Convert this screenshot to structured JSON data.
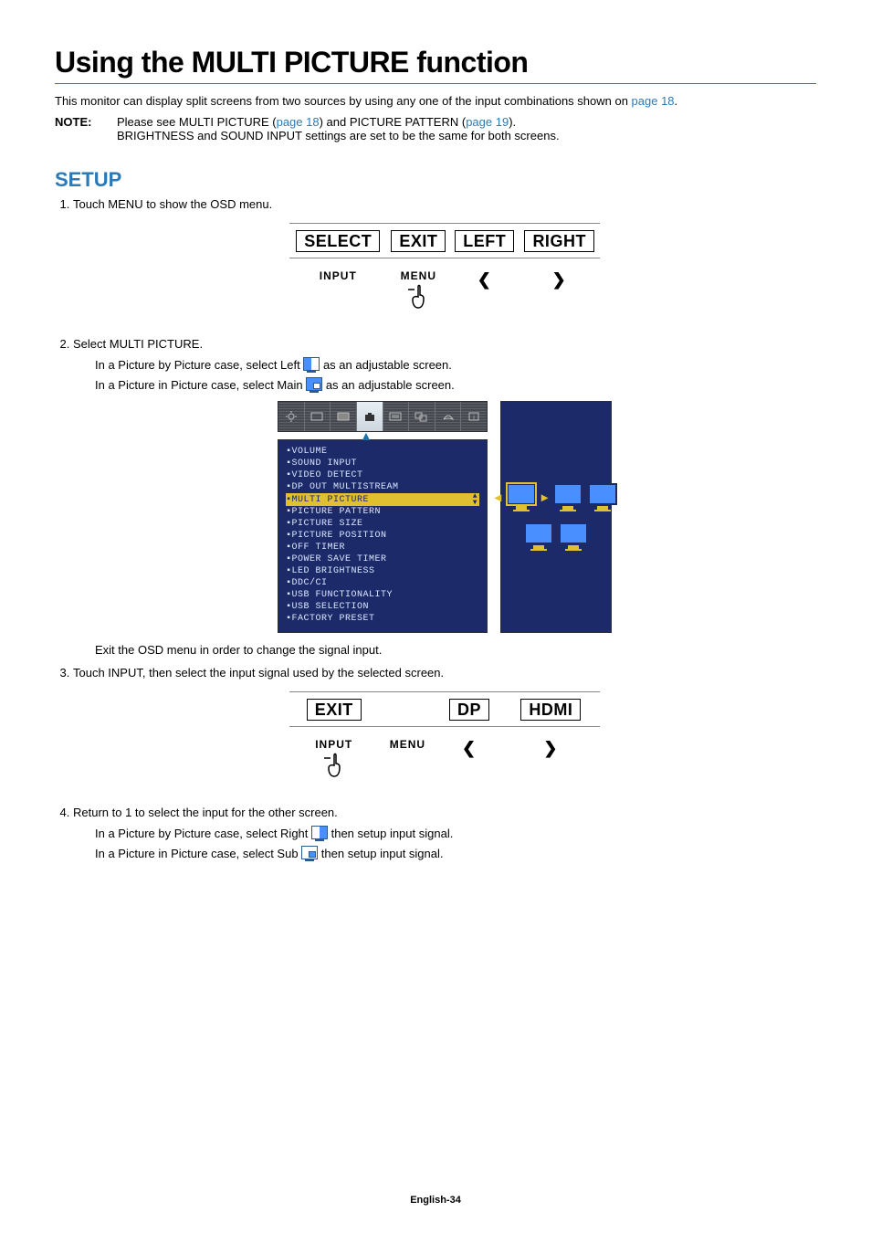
{
  "title": "Using the MULTI PICTURE function",
  "intro": "This monitor can display split screens from two sources by using any one of the input combinations shown on ",
  "intro_link": "page 18",
  "intro_after": ".",
  "note_label": "NOTE:",
  "note1_a": "Please see MULTI PICTURE (",
  "note1_link1": "page 18",
  "note1_b": ") and PICTURE PATTERN (",
  "note1_link2": "page 19",
  "note1_c": ").",
  "note2": "BRIGHTNESS and SOUND INPUT settings are set to be the same for both screens.",
  "setup_heading": "SETUP",
  "step1": "Touch MENU to show the OSD menu.",
  "step2_head": "Select MULTI PICTURE.",
  "step2_a1": "In a Picture by Picture case, select Left ",
  "step2_a2": " as an adjustable screen.",
  "step2_b1": "In a Picture in Picture case, select Main ",
  "step2_b2": " as an adjustable screen.",
  "step2_exit": "Exit the OSD menu in order to change the signal input.",
  "step3": "Touch INPUT, then select the input signal used by the selected screen.",
  "step4_head": "Return to 1 to select the input for the other screen.",
  "step4_a1": "In a Picture by Picture case, select Right ",
  "step4_a2": " then setup input signal.",
  "step4_b1": "In a Picture in Picture case, select Sub ",
  "step4_b2": " then setup input signal.",
  "fig1": {
    "top": [
      "SELECT",
      "EXIT",
      "LEFT",
      "RIGHT"
    ],
    "bottom": [
      "INPUT",
      "MENU",
      "<",
      ">"
    ],
    "pointer_col": 1
  },
  "osd": {
    "items_before": [
      "VOLUME",
      "SOUND INPUT",
      "VIDEO DETECT",
      "DP OUT MULTISTREAM"
    ],
    "highlight": "MULTI PICTURE",
    "items_after": [
      "PICTURE PATTERN",
      "PICTURE SIZE",
      "PICTURE POSITION",
      "OFF TIMER",
      "POWER SAVE TIMER",
      "LED BRIGHTNESS",
      "DDC/CI",
      "USB FUNCTIONALITY",
      "USB SELECTION",
      "FACTORY PRESET"
    ]
  },
  "fig3": {
    "top": [
      "EXIT",
      "",
      "DP",
      "HDMI"
    ],
    "bottom": [
      "INPUT",
      "MENU",
      "<",
      ">"
    ],
    "pointer_col": 0
  },
  "footer": "English-34"
}
